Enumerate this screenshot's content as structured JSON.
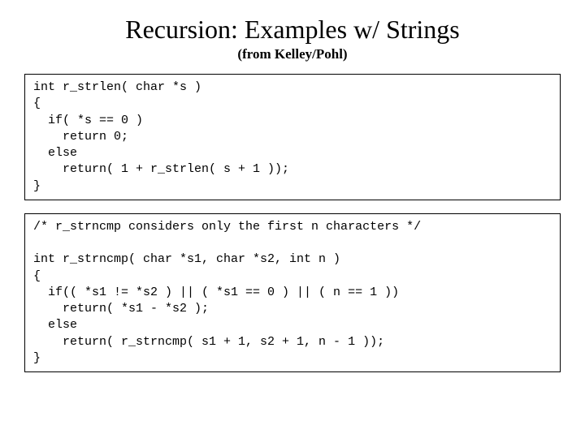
{
  "title": "Recursion: Examples w/ Strings",
  "subtitle": "(from Kelley/Pohl)",
  "code_block_1": "int r_strlen( char *s )\n{\n  if( *s == 0 )\n    return 0;\n  else\n    return( 1 + r_strlen( s + 1 ));\n}",
  "code_block_2": "/* r_strncmp considers only the first n characters */\n\nint r_strncmp( char *s1, char *s2, int n )\n{\n  if(( *s1 != *s2 ) || ( *s1 == 0 ) || ( n == 1 ))\n    return( *s1 - *s2 );\n  else\n    return( r_strncmp( s1 + 1, s2 + 1, n - 1 ));\n}"
}
